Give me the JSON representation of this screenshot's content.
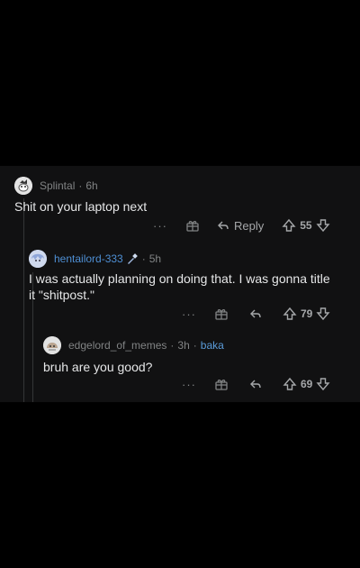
{
  "comments": [
    {
      "username": "Splintal",
      "sep": "·",
      "time": "6h",
      "flair": "",
      "text": "Shit on your laptop next",
      "reply_label": "Reply",
      "more_label": "···",
      "score": "55"
    },
    {
      "username": "hentailord-333",
      "sep": "·",
      "time": "5h",
      "flair": "",
      "text": "I was actually planning on doing that. I was gonna title it \"shitpost.\"",
      "reply_label": "",
      "more_label": "···",
      "score": "79"
    },
    {
      "username": "edgelord_of_memes",
      "sep": "·",
      "time": "3h",
      "sep2": "·",
      "flair": "baka",
      "text": "bruh are you good?",
      "reply_label": "",
      "more_label": "···",
      "score": "69"
    }
  ],
  "colors": {
    "background": "#000000",
    "panel": "#111112",
    "username_highlight": "#4e8fd4",
    "flair": "#5a9bd8",
    "muted": "#818384"
  },
  "icons": {
    "award": "gift-icon",
    "reply": "reply-arrow-icon",
    "upvote": "upvote-arrow-icon",
    "downvote": "downvote-arrow-icon",
    "more": "more-dots-icon"
  }
}
